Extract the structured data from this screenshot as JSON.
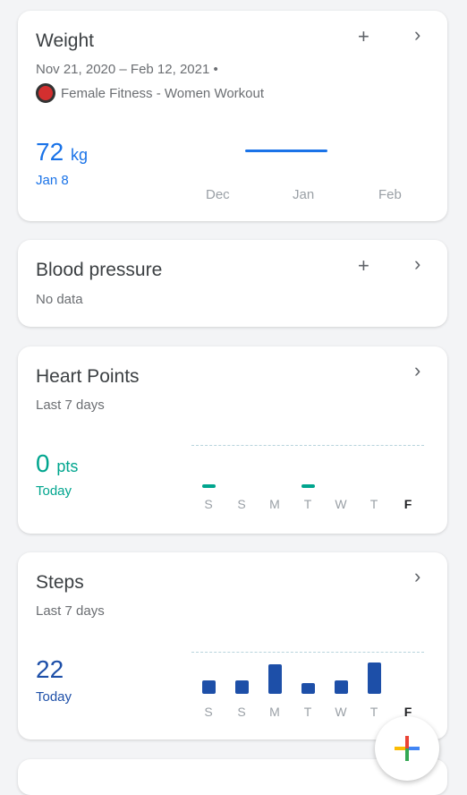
{
  "weight": {
    "title": "Weight",
    "range": "Nov 21, 2020 – Feb 12, 2021 •",
    "source": "Female Fitness - Women Workout",
    "value": "72",
    "unit": "kg",
    "date": "Jan 8",
    "months": [
      "Dec",
      "Jan",
      "Feb"
    ],
    "color": "#1a73e8"
  },
  "blood_pressure": {
    "title": "Blood pressure",
    "status": "No data"
  },
  "heart_points": {
    "title": "Heart Points",
    "period": "Last 7 days",
    "value": "0",
    "unit": "pts",
    "date": "Today",
    "days": [
      "S",
      "S",
      "M",
      "T",
      "W",
      "T",
      "F"
    ],
    "marks": [
      true,
      false,
      false,
      true,
      false,
      false,
      false
    ],
    "color": "#00a58e"
  },
  "steps": {
    "title": "Steps",
    "period": "Last 7 days",
    "value": "22",
    "date": "Today",
    "days": [
      "S",
      "S",
      "M",
      "T",
      "W",
      "T",
      "F"
    ],
    "relative_values": [
      0.35,
      0.33,
      0.75,
      0.28,
      0.33,
      0.8,
      0
    ],
    "color": "#1d4fa8"
  },
  "icons": {
    "add": "+",
    "chevron": "›"
  }
}
